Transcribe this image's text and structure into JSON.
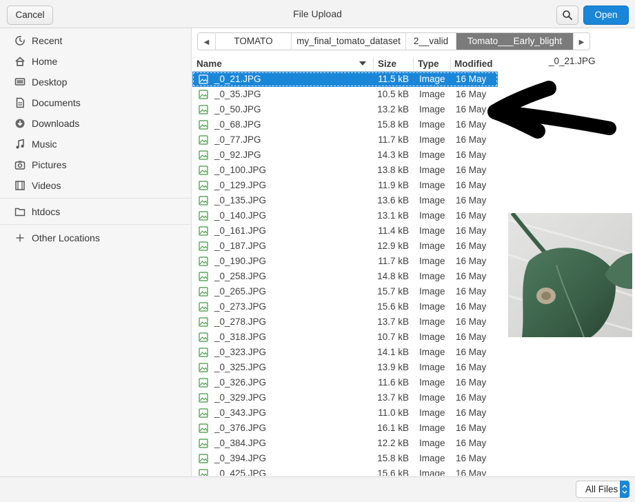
{
  "window": {
    "title": "File Upload",
    "cancel_label": "Cancel",
    "open_label": "Open",
    "search_icon": "search-icon"
  },
  "sidebar": {
    "items": [
      {
        "label": "Recent",
        "icon": "clock-icon"
      },
      {
        "label": "Home",
        "icon": "home-icon"
      },
      {
        "label": "Desktop",
        "icon": "desktop-icon"
      },
      {
        "label": "Documents",
        "icon": "document-icon"
      },
      {
        "label": "Downloads",
        "icon": "download-icon"
      },
      {
        "label": "Music",
        "icon": "music-icon"
      },
      {
        "label": "Pictures",
        "icon": "camera-icon"
      },
      {
        "label": "Videos",
        "icon": "film-icon"
      },
      {
        "label": "htdocs",
        "icon": "folder-icon"
      },
      {
        "label": "Other Locations",
        "icon": "plus-icon"
      }
    ]
  },
  "pathbar": {
    "crumbs": [
      "TOMATO",
      "my_final_tomato_dataset",
      "2__valid",
      "Tomato___Early_blight"
    ],
    "active_index": 3
  },
  "columns": {
    "name": "Name",
    "size": "Size",
    "type": "Type",
    "modified": "Modified"
  },
  "files": [
    {
      "name": "_0_21.JPG",
      "size": "11.5 kB",
      "type": "Image",
      "modified": "16 May",
      "selected": true
    },
    {
      "name": "_0_35.JPG",
      "size": "10.5 kB",
      "type": "Image",
      "modified": "16 May"
    },
    {
      "name": "_0_50.JPG",
      "size": "13.2 kB",
      "type": "Image",
      "modified": "16 May"
    },
    {
      "name": "_0_68.JPG",
      "size": "15.8 kB",
      "type": "Image",
      "modified": "16 May"
    },
    {
      "name": "_0_77.JPG",
      "size": "11.7 kB",
      "type": "Image",
      "modified": "16 May"
    },
    {
      "name": "_0_92.JPG",
      "size": "14.3 kB",
      "type": "Image",
      "modified": "16 May"
    },
    {
      "name": "_0_100.JPG",
      "size": "13.8 kB",
      "type": "Image",
      "modified": "16 May"
    },
    {
      "name": "_0_129.JPG",
      "size": "11.9 kB",
      "type": "Image",
      "modified": "16 May"
    },
    {
      "name": "_0_135.JPG",
      "size": "13.6 kB",
      "type": "Image",
      "modified": "16 May"
    },
    {
      "name": "_0_140.JPG",
      "size": "13.1 kB",
      "type": "Image",
      "modified": "16 May"
    },
    {
      "name": "_0_161.JPG",
      "size": "11.4 kB",
      "type": "Image",
      "modified": "16 May"
    },
    {
      "name": "_0_187.JPG",
      "size": "12.9 kB",
      "type": "Image",
      "modified": "16 May"
    },
    {
      "name": "_0_190.JPG",
      "size": "11.7 kB",
      "type": "Image",
      "modified": "16 May"
    },
    {
      "name": "_0_258.JPG",
      "size": "14.8 kB",
      "type": "Image",
      "modified": "16 May"
    },
    {
      "name": "_0_265.JPG",
      "size": "15.7 kB",
      "type": "Image",
      "modified": "16 May"
    },
    {
      "name": "_0_273.JPG",
      "size": "15.6 kB",
      "type": "Image",
      "modified": "16 May"
    },
    {
      "name": "_0_278.JPG",
      "size": "13.7 kB",
      "type": "Image",
      "modified": "16 May"
    },
    {
      "name": "_0_318.JPG",
      "size": "10.7 kB",
      "type": "Image",
      "modified": "16 May"
    },
    {
      "name": "_0_323.JPG",
      "size": "14.1 kB",
      "type": "Image",
      "modified": "16 May"
    },
    {
      "name": "_0_325.JPG",
      "size": "13.9 kB",
      "type": "Image",
      "modified": "16 May"
    },
    {
      "name": "_0_326.JPG",
      "size": "11.6 kB",
      "type": "Image",
      "modified": "16 May"
    },
    {
      "name": "_0_329.JPG",
      "size": "13.7 kB",
      "type": "Image",
      "modified": "16 May"
    },
    {
      "name": "_0_343.JPG",
      "size": "11.0 kB",
      "type": "Image",
      "modified": "16 May"
    },
    {
      "name": "_0_376.JPG",
      "size": "16.1 kB",
      "type": "Image",
      "modified": "16 May"
    },
    {
      "name": "_0_384.JPG",
      "size": "12.2 kB",
      "type": "Image",
      "modified": "16 May"
    },
    {
      "name": "_0_394.JPG",
      "size": "15.8 kB",
      "type": "Image",
      "modified": "16 May"
    },
    {
      "name": "_0_425.JPG",
      "size": "15.6 kB",
      "type": "Image",
      "modified": "16 May"
    }
  ],
  "preview": {
    "filename": "_0_21.JPG"
  },
  "footer": {
    "filter_label": "All Files"
  },
  "colors": {
    "accent": "#1a86d8",
    "active_crumb": "#7b7b7b",
    "file_icon": "#3a9a3a"
  }
}
